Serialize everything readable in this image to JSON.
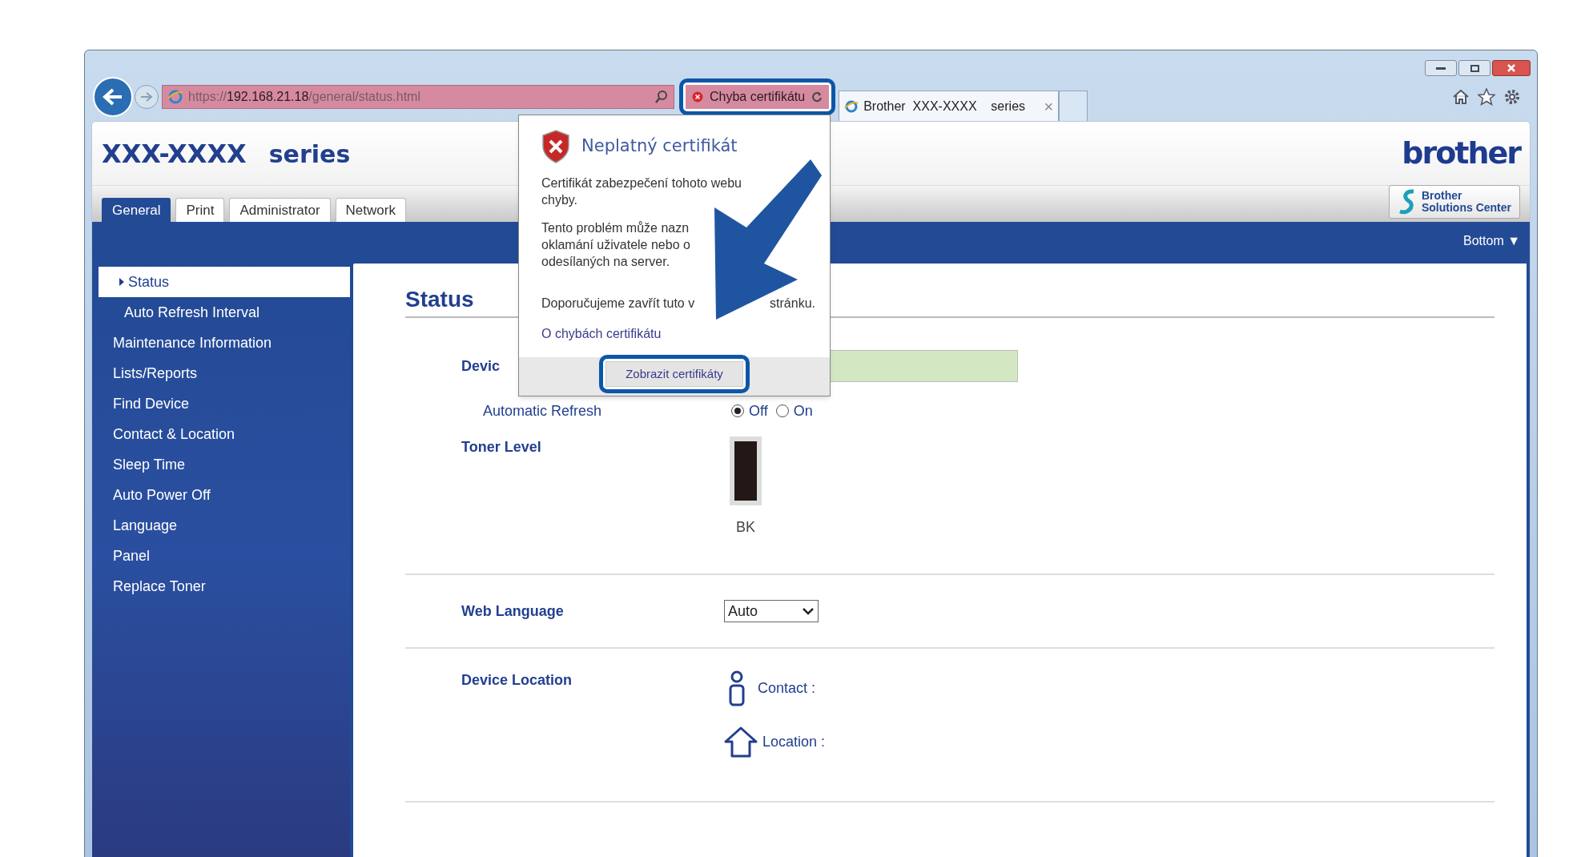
{
  "browser": {
    "address": {
      "scheme": "https://",
      "host": "192.168.21.18",
      "path": "/general/status.html"
    },
    "cert_error": "Chyba certifikátu",
    "tab": {
      "title": "Brother  XXX-XXXX    series",
      "close": "×"
    }
  },
  "header": {
    "model": "XXX-XXXX",
    "series": "series",
    "logo": "brother",
    "solutions": [
      "Brother",
      "Solutions Center"
    ]
  },
  "tabs": [
    {
      "label": "General",
      "selected": true
    },
    {
      "label": "Print",
      "selected": false
    },
    {
      "label": "Administrator",
      "selected": false
    },
    {
      "label": "Network",
      "selected": false
    }
  ],
  "bottom_link": "Bottom ▼",
  "sidebar": {
    "items": [
      {
        "label": "Status",
        "selected": true,
        "children": [
          {
            "label": "Auto Refresh Interval",
            "selected": false
          }
        ]
      },
      {
        "label": "Maintenance Information",
        "selected": false
      },
      {
        "label": "Lists/Reports",
        "selected": false
      },
      {
        "label": "Find Device",
        "selected": false
      },
      {
        "label": "Contact & Location",
        "selected": false
      },
      {
        "label": "Sleep Time",
        "selected": false
      },
      {
        "label": "Auto Power Off",
        "selected": false
      },
      {
        "label": "Language",
        "selected": false
      },
      {
        "label": "Panel",
        "selected": false
      },
      {
        "label": "Replace Toner",
        "selected": false
      }
    ]
  },
  "content": {
    "title": "Status",
    "device_label": "Devic",
    "auto_refresh": {
      "label": "Automatic Refresh",
      "options": [
        {
          "label": "Off",
          "selected": true
        },
        {
          "label": "On",
          "selected": false
        }
      ]
    },
    "toner": {
      "label": "Toner Level",
      "level": 1,
      "name": "BK"
    },
    "web_language": {
      "label": "Web Language",
      "value": "Auto"
    },
    "device_location": {
      "label": "Device Location",
      "contact": "Contact :",
      "location": "Location :"
    }
  },
  "popup": {
    "title": "Neplatný certifikát",
    "paragraphs": [
      [
        "Certifikát zabezpečení tohoto webu",
        "chyby."
      ],
      [
        "Tento problém může nazn",
        "oklamání uživatele nebo o",
        "odesílaných na server."
      ]
    ],
    "recommend": [
      "Doporučujeme zavřít tuto v",
      "stránku."
    ],
    "link": "O chybách certifikátu",
    "button": "Zobrazit certifikáty"
  }
}
